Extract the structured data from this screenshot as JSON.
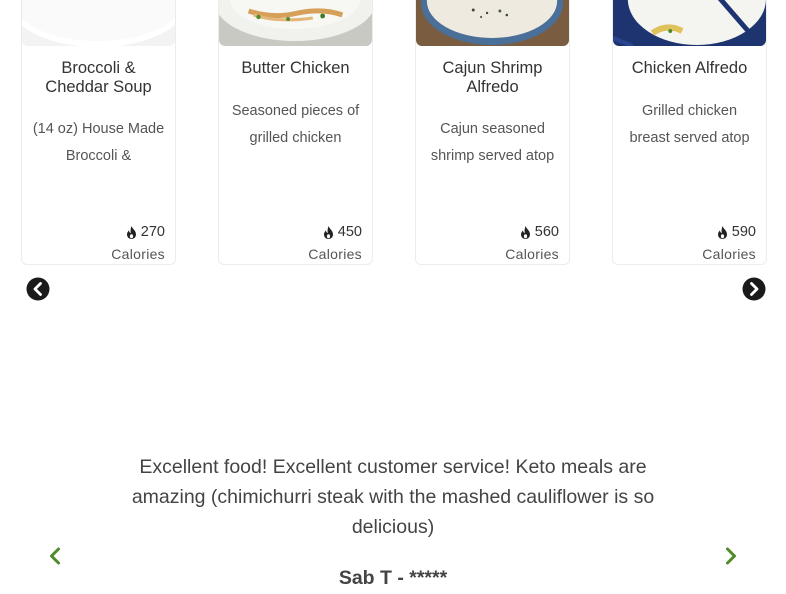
{
  "menu_items": [
    {
      "title": "Broccoli & Cheddar Soup",
      "description": "(14 oz) House Made Broccoli &",
      "calories": "270",
      "calories_label": "Calories"
    },
    {
      "title": "Butter Chicken",
      "description": "Seasoned pieces of grilled chicken",
      "calories": "450",
      "calories_label": "Calories"
    },
    {
      "title": "Cajun Shrimp Alfredo",
      "description": "Cajun seasoned shrimp served atop",
      "calories": "560",
      "calories_label": "Calories"
    },
    {
      "title": "Chicken Alfredo",
      "description": "Grilled chicken breast served atop",
      "calories": "590",
      "calories_label": "Calories"
    }
  ],
  "carousel": {
    "prev_icon": "circle-chevron-left-icon",
    "next_icon": "circle-chevron-right-icon"
  },
  "testimonial": {
    "text": "Excellent food! Excellent customer service! Keto meals are amazing (chimichurri steak with the mashed cauliflower is so delicious)",
    "author": "Sab T - *****",
    "prev_icon": "chevron-left-icon",
    "next_icon": "chevron-right-icon",
    "arrow_color": "#4f8a2b"
  }
}
